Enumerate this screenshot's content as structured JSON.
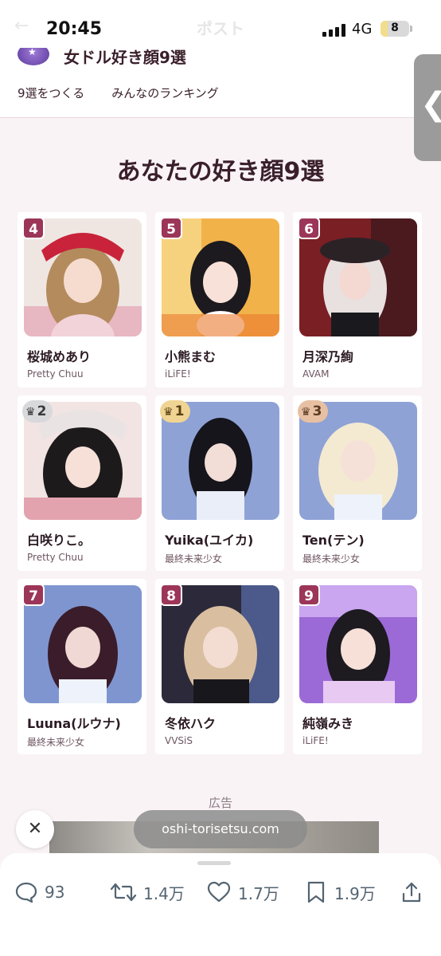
{
  "status": {
    "time": "20:45",
    "network": "4G",
    "battery": "8",
    "battery_level": 0.08
  },
  "ghost": {
    "back": "←",
    "title": "ポスト"
  },
  "site": {
    "title": "女ドル好き顔9選"
  },
  "nav": [
    {
      "label": "9選をつくる"
    },
    {
      "label": "みんなのランキング"
    }
  ],
  "side_handle": "❮",
  "section_title": "あなたの好き顔9選",
  "cards": [
    {
      "rank": "4",
      "name": "桜城めあり",
      "group": "Pretty Chuu",
      "crown": false
    },
    {
      "rank": "5",
      "name": "小熊まむ",
      "group": "iLiFE!",
      "crown": false
    },
    {
      "rank": "6",
      "name": "月深乃絢",
      "group": "AVAM",
      "crown": false
    },
    {
      "rank": "2",
      "name": "白咲りこ。",
      "group": "Pretty Chuu",
      "crown": true,
      "medal": "silver"
    },
    {
      "rank": "1",
      "name": "Yuika(ユイカ)",
      "group": "最終未来少女",
      "crown": true,
      "medal": "gold"
    },
    {
      "rank": "3",
      "name": "Ten(テン)",
      "group": "最終未来少女",
      "crown": true,
      "medal": "bronze"
    },
    {
      "rank": "7",
      "name": "Luuna(ルウナ)",
      "group": "最終未来少女",
      "crown": false
    },
    {
      "rank": "8",
      "name": "冬依ハク",
      "group": "VVSiS",
      "crown": false
    },
    {
      "rank": "9",
      "name": "純嶺みき",
      "group": "iLiFE!",
      "crown": false
    }
  ],
  "ad": {
    "label": "広告",
    "close": "✕",
    "url": "oshi-torisetsu.com"
  },
  "actions": {
    "replies": "93",
    "reposts": "1.4万",
    "likes": "1.7万",
    "bookmarks": "1.9万"
  },
  "colors": {
    "accent": "#9c3659",
    "background": "#f9f3f6",
    "text": "#3a1f2a"
  }
}
